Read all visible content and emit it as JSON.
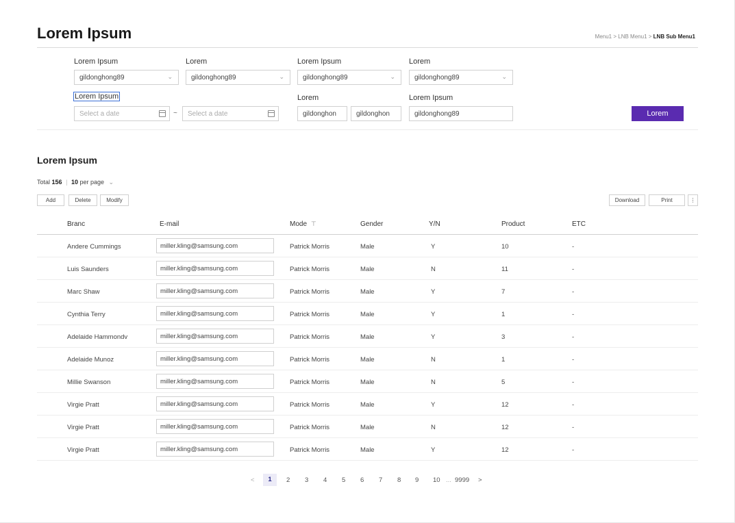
{
  "header": {
    "title": "Lorem Ipsum",
    "breadcrumb": [
      "Menu1",
      "LNB Menu1",
      "LNB Sub Menu1"
    ],
    "breadcrumb_sep": ">"
  },
  "filters": {
    "row1": [
      {
        "label": "Lorem Ipsum",
        "value": "gildonghong89"
      },
      {
        "label": "Lorem",
        "value": "gildonghong89"
      },
      {
        "label": "Lorem Ipsum",
        "value": "gildonghong89"
      },
      {
        "label": "Lorem",
        "value": "gildonghong89"
      }
    ],
    "date_label": "Lorem Ipsum",
    "date_from_placeholder": "Select a date",
    "date_to_placeholder": "Select a date",
    "date_sep": "~",
    "pair_label": "Lorem",
    "pair_value1": "gildonghon",
    "pair_value2": "gildonghon",
    "last_label": "Lorem Ipsum",
    "last_value": "gildonghong89",
    "search_button": "Lorem"
  },
  "list": {
    "title": "Lorem Ipsum",
    "total_label": "Total",
    "total_count": "156",
    "per_page_value": "10",
    "per_page_label": "per page",
    "buttons": {
      "add": "Add",
      "delete": "Delete",
      "modify": "Modify",
      "download": "Download",
      "print": "Print",
      "more": "⋮"
    },
    "columns": [
      "Branc",
      "E-mail",
      "Mode",
      "Gender",
      "Y/N",
      "Product",
      "ETC"
    ],
    "rows": [
      {
        "branch": "Andere Cummings",
        "email": "miller.kling@samsung.com",
        "mode": "Patrick Morris",
        "gender": "Male",
        "yn": "Y",
        "product": "10",
        "etc": "-"
      },
      {
        "branch": "Luis Saunders",
        "email": "miller.kling@samsung.com",
        "mode": "Patrick Morris",
        "gender": "Male",
        "yn": "N",
        "product": "11",
        "etc": "-"
      },
      {
        "branch": "Marc Shaw",
        "email": "miller.kling@samsung.com",
        "mode": "Patrick Morris",
        "gender": "Male",
        "yn": "Y",
        "product": "7",
        "etc": "-"
      },
      {
        "branch": "Cynthia Terry",
        "email": "miller.kling@samsung.com",
        "mode": "Patrick Morris",
        "gender": "Male",
        "yn": "Y",
        "product": "1",
        "etc": "-"
      },
      {
        "branch": "Adelaide Hammondv",
        "email": "miller.kling@samsung.com",
        "mode": "Patrick Morris",
        "gender": "Male",
        "yn": "Y",
        "product": "3",
        "etc": "-"
      },
      {
        "branch": "Adelaide Munoz",
        "email": "miller.kling@samsung.com",
        "mode": "Patrick Morris",
        "gender": "Male",
        "yn": "N",
        "product": "1",
        "etc": "-"
      },
      {
        "branch": "Millie Swanson",
        "email": "miller.kling@samsung.com",
        "mode": "Patrick Morris",
        "gender": "Male",
        "yn": "N",
        "product": "5",
        "etc": "-"
      },
      {
        "branch": "Virgie Pratt",
        "email": "miller.kling@samsung.com",
        "mode": "Patrick Morris",
        "gender": "Male",
        "yn": "Y",
        "product": "12",
        "etc": "-"
      },
      {
        "branch": "Virgie Pratt",
        "email": "miller.kling@samsung.com",
        "mode": "Patrick Morris",
        "gender": "Male",
        "yn": "N",
        "product": "12",
        "etc": "-"
      },
      {
        "branch": "Virgie Pratt",
        "email": "miller.kling@samsung.com",
        "mode": "Patrick Morris",
        "gender": "Male",
        "yn": "Y",
        "product": "12",
        "etc": "-"
      }
    ]
  },
  "pagination": {
    "prev": "<",
    "next": ">",
    "pages": [
      "1",
      "2",
      "3",
      "4",
      "5",
      "6",
      "7",
      "8",
      "9",
      "10"
    ],
    "ellipsis": "...",
    "last": "9999",
    "current": "1"
  },
  "colors": {
    "accent": "#5a2bb0",
    "active_page_bg": "#ecebf7"
  }
}
